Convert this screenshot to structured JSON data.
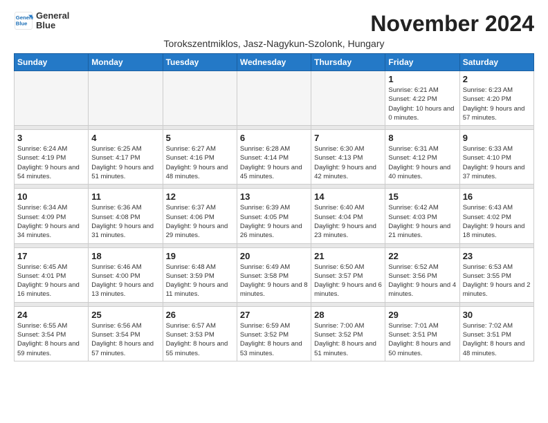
{
  "logo": {
    "line1": "General",
    "line2": "Blue"
  },
  "title": "November 2024",
  "subtitle": "Torokszentmiklos, Jasz-Nagykun-Szolonk, Hungary",
  "subtitle_full": "Torokszentmiklos, Jasz-Nagykun-Szolonk, Hungary",
  "days_of_week": [
    "Sunday",
    "Monday",
    "Tuesday",
    "Wednesday",
    "Thursday",
    "Friday",
    "Saturday"
  ],
  "weeks": [
    [
      {
        "day": "",
        "info": ""
      },
      {
        "day": "",
        "info": ""
      },
      {
        "day": "",
        "info": ""
      },
      {
        "day": "",
        "info": ""
      },
      {
        "day": "",
        "info": ""
      },
      {
        "day": "1",
        "info": "Sunrise: 6:21 AM\nSunset: 4:22 PM\nDaylight: 10 hours\nand 0 minutes."
      },
      {
        "day": "2",
        "info": "Sunrise: 6:23 AM\nSunset: 4:20 PM\nDaylight: 9 hours\nand 57 minutes."
      }
    ],
    [
      {
        "day": "3",
        "info": "Sunrise: 6:24 AM\nSunset: 4:19 PM\nDaylight: 9 hours\nand 54 minutes."
      },
      {
        "day": "4",
        "info": "Sunrise: 6:25 AM\nSunset: 4:17 PM\nDaylight: 9 hours\nand 51 minutes."
      },
      {
        "day": "5",
        "info": "Sunrise: 6:27 AM\nSunset: 4:16 PM\nDaylight: 9 hours\nand 48 minutes."
      },
      {
        "day": "6",
        "info": "Sunrise: 6:28 AM\nSunset: 4:14 PM\nDaylight: 9 hours\nand 45 minutes."
      },
      {
        "day": "7",
        "info": "Sunrise: 6:30 AM\nSunset: 4:13 PM\nDaylight: 9 hours\nand 42 minutes."
      },
      {
        "day": "8",
        "info": "Sunrise: 6:31 AM\nSunset: 4:12 PM\nDaylight: 9 hours\nand 40 minutes."
      },
      {
        "day": "9",
        "info": "Sunrise: 6:33 AM\nSunset: 4:10 PM\nDaylight: 9 hours\nand 37 minutes."
      }
    ],
    [
      {
        "day": "10",
        "info": "Sunrise: 6:34 AM\nSunset: 4:09 PM\nDaylight: 9 hours\nand 34 minutes."
      },
      {
        "day": "11",
        "info": "Sunrise: 6:36 AM\nSunset: 4:08 PM\nDaylight: 9 hours\nand 31 minutes."
      },
      {
        "day": "12",
        "info": "Sunrise: 6:37 AM\nSunset: 4:06 PM\nDaylight: 9 hours\nand 29 minutes."
      },
      {
        "day": "13",
        "info": "Sunrise: 6:39 AM\nSunset: 4:05 PM\nDaylight: 9 hours\nand 26 minutes."
      },
      {
        "day": "14",
        "info": "Sunrise: 6:40 AM\nSunset: 4:04 PM\nDaylight: 9 hours\nand 23 minutes."
      },
      {
        "day": "15",
        "info": "Sunrise: 6:42 AM\nSunset: 4:03 PM\nDaylight: 9 hours\nand 21 minutes."
      },
      {
        "day": "16",
        "info": "Sunrise: 6:43 AM\nSunset: 4:02 PM\nDaylight: 9 hours\nand 18 minutes."
      }
    ],
    [
      {
        "day": "17",
        "info": "Sunrise: 6:45 AM\nSunset: 4:01 PM\nDaylight: 9 hours\nand 16 minutes."
      },
      {
        "day": "18",
        "info": "Sunrise: 6:46 AM\nSunset: 4:00 PM\nDaylight: 9 hours\nand 13 minutes."
      },
      {
        "day": "19",
        "info": "Sunrise: 6:48 AM\nSunset: 3:59 PM\nDaylight: 9 hours\nand 11 minutes."
      },
      {
        "day": "20",
        "info": "Sunrise: 6:49 AM\nSunset: 3:58 PM\nDaylight: 9 hours\nand 8 minutes."
      },
      {
        "day": "21",
        "info": "Sunrise: 6:50 AM\nSunset: 3:57 PM\nDaylight: 9 hours\nand 6 minutes."
      },
      {
        "day": "22",
        "info": "Sunrise: 6:52 AM\nSunset: 3:56 PM\nDaylight: 9 hours\nand 4 minutes."
      },
      {
        "day": "23",
        "info": "Sunrise: 6:53 AM\nSunset: 3:55 PM\nDaylight: 9 hours\nand 2 minutes."
      }
    ],
    [
      {
        "day": "24",
        "info": "Sunrise: 6:55 AM\nSunset: 3:54 PM\nDaylight: 8 hours\nand 59 minutes."
      },
      {
        "day": "25",
        "info": "Sunrise: 6:56 AM\nSunset: 3:54 PM\nDaylight: 8 hours\nand 57 minutes."
      },
      {
        "day": "26",
        "info": "Sunrise: 6:57 AM\nSunset: 3:53 PM\nDaylight: 8 hours\nand 55 minutes."
      },
      {
        "day": "27",
        "info": "Sunrise: 6:59 AM\nSunset: 3:52 PM\nDaylight: 8 hours\nand 53 minutes."
      },
      {
        "day": "28",
        "info": "Sunrise: 7:00 AM\nSunset: 3:52 PM\nDaylight: 8 hours\nand 51 minutes."
      },
      {
        "day": "29",
        "info": "Sunrise: 7:01 AM\nSunset: 3:51 PM\nDaylight: 8 hours\nand 50 minutes."
      },
      {
        "day": "30",
        "info": "Sunrise: 7:02 AM\nSunset: 3:51 PM\nDaylight: 8 hours\nand 48 minutes."
      }
    ]
  ]
}
